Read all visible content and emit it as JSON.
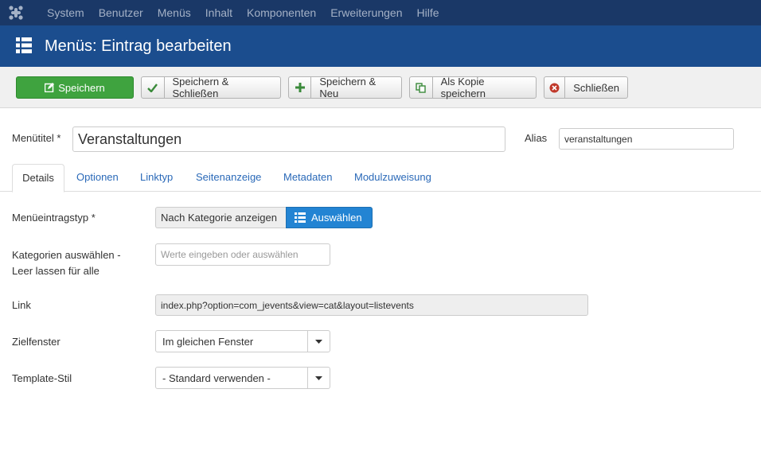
{
  "topnav": {
    "logo_icon": "joomla-logo-icon",
    "items": [
      "System",
      "Benutzer",
      "Menüs",
      "Inhalt",
      "Komponenten",
      "Erweiterungen",
      "Hilfe"
    ]
  },
  "header": {
    "title": "Menüs: Eintrag bearbeiten",
    "icon": "list-icon"
  },
  "toolbar": {
    "save": "Speichern",
    "save_close": "Speichern & Schließen",
    "save_new": "Speichern & Neu",
    "save_copy": "Als Kopie speichern",
    "close": "Schließen"
  },
  "form": {
    "title_label": "Menütitel *",
    "title_value": "Veranstaltungen",
    "alias_label": "Alias",
    "alias_value": "veranstaltungen"
  },
  "tabs": [
    "Details",
    "Optionen",
    "Linktyp",
    "Seitenanzeige",
    "Metadaten",
    "Modulzuweisung"
  ],
  "details": {
    "menutype_label": "Menüeintragstyp *",
    "menutype_value": "Nach Kategorie anzeigen",
    "select_button": "Auswählen",
    "categories_label_1": "Kategorien auswählen -",
    "categories_label_2": "Leer lassen für alle",
    "categories_placeholder": "Werte eingeben oder auswählen",
    "link_label": "Link",
    "link_value": "index.php?option=com_jevents&view=cat&layout=listevents",
    "target_label": "Zielfenster",
    "target_value": "Im gleichen Fenster",
    "template_label": "Template-Stil",
    "template_value": "- Standard verwenden -"
  },
  "colors": {
    "topnav": "#1a3867",
    "header": "#1b4d8e",
    "save": "#3fa33f",
    "select": "#2384d3",
    "link": "#2a69b8"
  }
}
